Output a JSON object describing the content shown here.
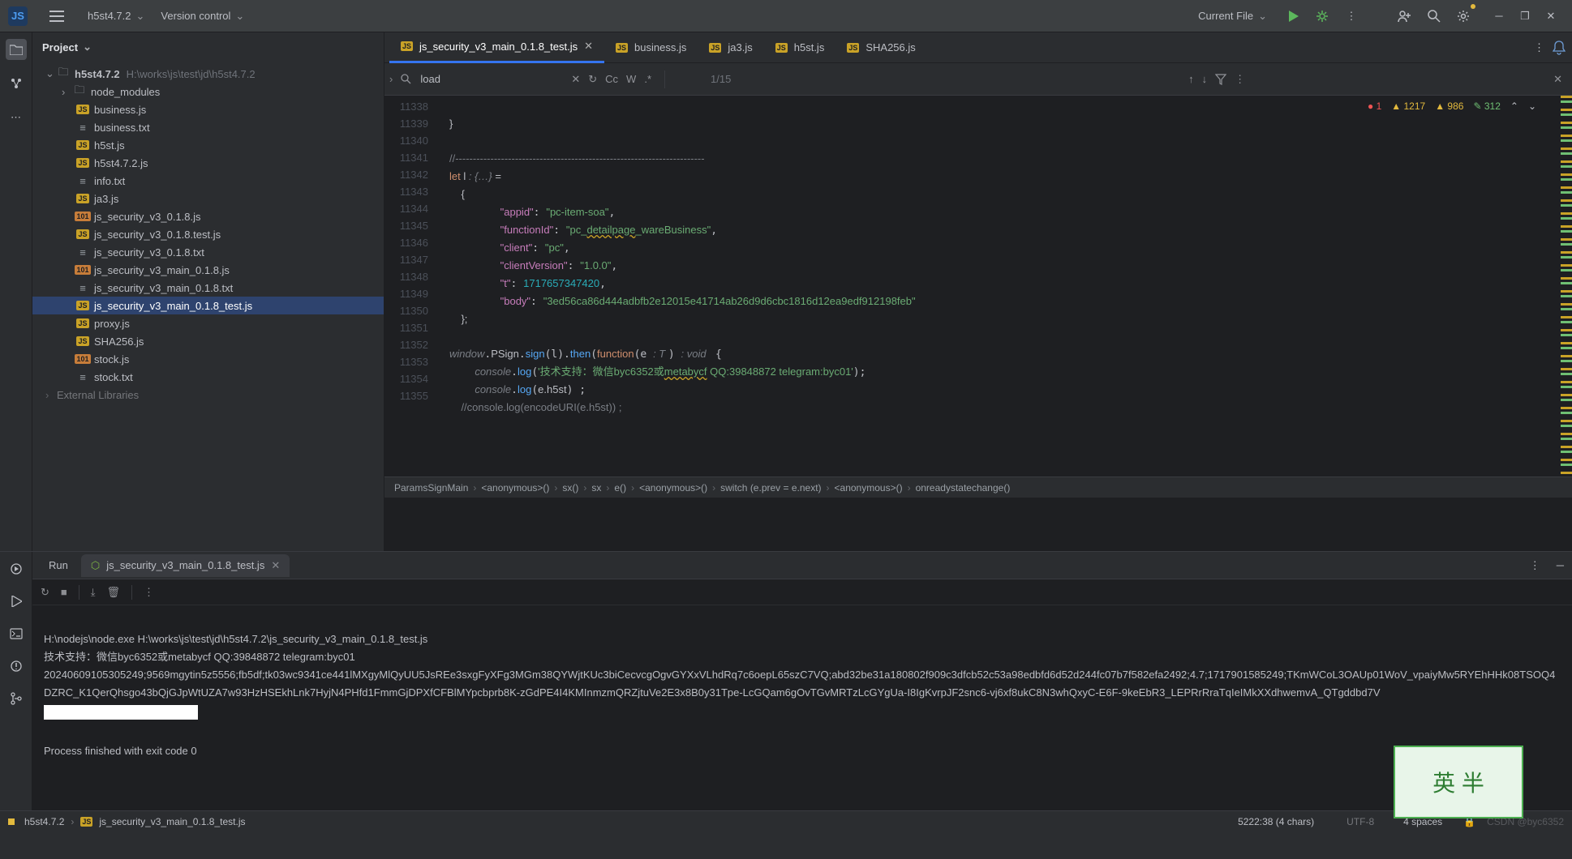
{
  "titlebar": {
    "project": "h5st4.7.2",
    "vcs": "Version control",
    "run_config": "Current File"
  },
  "project_panel": {
    "title": "Project",
    "root": "h5st4.7.2",
    "root_path": "H:\\works\\js\\test\\jd\\h5st4.7.2",
    "node_modules": "node_modules",
    "files": [
      {
        "name": "business.js",
        "type": "js"
      },
      {
        "name": "business.txt",
        "type": "txt"
      },
      {
        "name": "h5st.js",
        "type": "js"
      },
      {
        "name": "h5st4.7.2.js",
        "type": "js"
      },
      {
        "name": "info.txt",
        "type": "txt"
      },
      {
        "name": "ja3.js",
        "type": "js"
      },
      {
        "name": "js_security_v3_0.1.8.js",
        "type": "js2"
      },
      {
        "name": "js_security_v3_0.1.8.test.js",
        "type": "js"
      },
      {
        "name": "js_security_v3_0.1.8.txt",
        "type": "txt"
      },
      {
        "name": "js_security_v3_main_0.1.8.js",
        "type": "js2"
      },
      {
        "name": "js_security_v3_main_0.1.8.txt",
        "type": "txt"
      },
      {
        "name": "js_security_v3_main_0.1.8_test.js",
        "type": "js"
      },
      {
        "name": "proxy.js",
        "type": "js"
      },
      {
        "name": "SHA256.js",
        "type": "js"
      },
      {
        "name": "stock.js",
        "type": "js2"
      },
      {
        "name": "stock.txt",
        "type": "txt"
      }
    ],
    "external": "External Libraries"
  },
  "tabs": [
    {
      "name": "js_security_v3_main_0.1.8_test.js",
      "active": true,
      "close": true
    },
    {
      "name": "business.js"
    },
    {
      "name": "ja3.js"
    },
    {
      "name": "h5st.js"
    },
    {
      "name": "SHA256.js"
    }
  ],
  "search": {
    "query": "load",
    "count": "1/15"
  },
  "code_meta": {
    "errors": "1",
    "warnings": "1217",
    "weak": "986",
    "typos": "312"
  },
  "gutter_start": 11338,
  "gutter_end": 11355,
  "code_lines": {
    "l0": "}",
    "l2_dash": "//-----------------------------------------------------------------------",
    "l3_let": "let",
    "l3_l": " l ",
    "l3_hint": ": {…} ",
    "l3_eq": "=",
    "l4": "    {",
    "l5_k": "\"appid\"",
    "l5_v": "\"pc-item-soa\"",
    "l6_k": "\"functionId\"",
    "l6_vpre": "\"pc_",
    "l6_vu": "detailpage",
    "l6_vp": "_wareBusiness\"",
    "l7_k": "\"client\"",
    "l7_v": "\"pc\"",
    "l8_k": "\"clientVersion\"",
    "l8_v": "\"1.0.0\"",
    "l9_k": "\"t\"",
    "l9_v": "1717657347420",
    "l10_k": "\"body\"",
    "l10_v": "\"3ed56ca86d444adbfb2e12015e41714ab26d9d6cbc1816d12ea9edf912198feb\"",
    "l11": "    };",
    "l13_win": "window",
    "l13_psign": "PSign",
    "l13_sign": "sign",
    "l13_then": "then",
    "l13_func": "function",
    "l13_hint": ": T ",
    "l13_ret": ": void ",
    "l14_cons": "console",
    "l14_log": "log",
    "l14_s1": "'技术支持：微信byc6352或",
    "l14_su": "metabycf",
    "l14_s2": " QQ:39848872 telegram:byc01'",
    "l15_cons": "console",
    "l15_log": "log",
    "l15_expr": "e.h5st",
    "l16": "    //console.log(encodeURI(e.h5st)) ;"
  },
  "breadcrumb": [
    "ParamsSignMain",
    "<anonymous>()",
    "sx()",
    "sx",
    "e()",
    "<anonymous>()",
    "switch (e.prev = e.next)",
    "<anonymous>()",
    "onreadystatechange()"
  ],
  "run_panel": {
    "tab1": "Run",
    "tab2": "js_security_v3_main_0.1.8_test.js",
    "line1": "H:\\nodejs\\node.exe H:\\works\\js\\test\\jd\\h5st4.7.2\\js_security_v3_main_0.1.8_test.js",
    "line2": "技术支持：微信byc6352或metabycf QQ:39848872 telegram:byc01",
    "line3": "20240609105305249;9569mgytin5z5556;fb5df;tk03wc9341ce441lMXgyMlQyUU5JsREe3sxgFyXFg3MGm38QYWjtKUc3biCecvcgOgvGYXxVLhdRq7c6oepL65szC7VQ;abd32be31a180802f909c3dfcb52c53a98edbfd6d52d244fc07b7f582efa2492;4.7;1717901585249;TKmWCoL3OAUp01WoV_vpaiyMw5RYEhHHk08TSOQ4DZRC_K1QerQhsgo43bQjGJpWtUZA7w93HzHSEkhLnk7HyjN4PHfd1FmmGjDPXfCFBlMYpcbprb8K-zGdPE4I4KMInmzmQRZjtuVe2E3x8B0y31Tpe-LcGQam6gOvTGvMRTzLcGYgUa-I8IgKvrpJF2snc6-vj6xf8ukC8N3whQxyC-E6F-9keEbR3_LEPRrRraTqIeIMkXXdhwemvA_QTgddbd7V",
    "exit": "Process finished with exit code 0"
  },
  "statusbar": {
    "root": "h5st4.7.2",
    "file": "js_security_v3_main_0.1.8_test.js",
    "pos": "5222:38 (4 chars)",
    "enc": "UTF-8",
    "spaces": "4 spaces",
    "watermark": "CSDN @byc6352"
  },
  "overlay_text": "英    半"
}
